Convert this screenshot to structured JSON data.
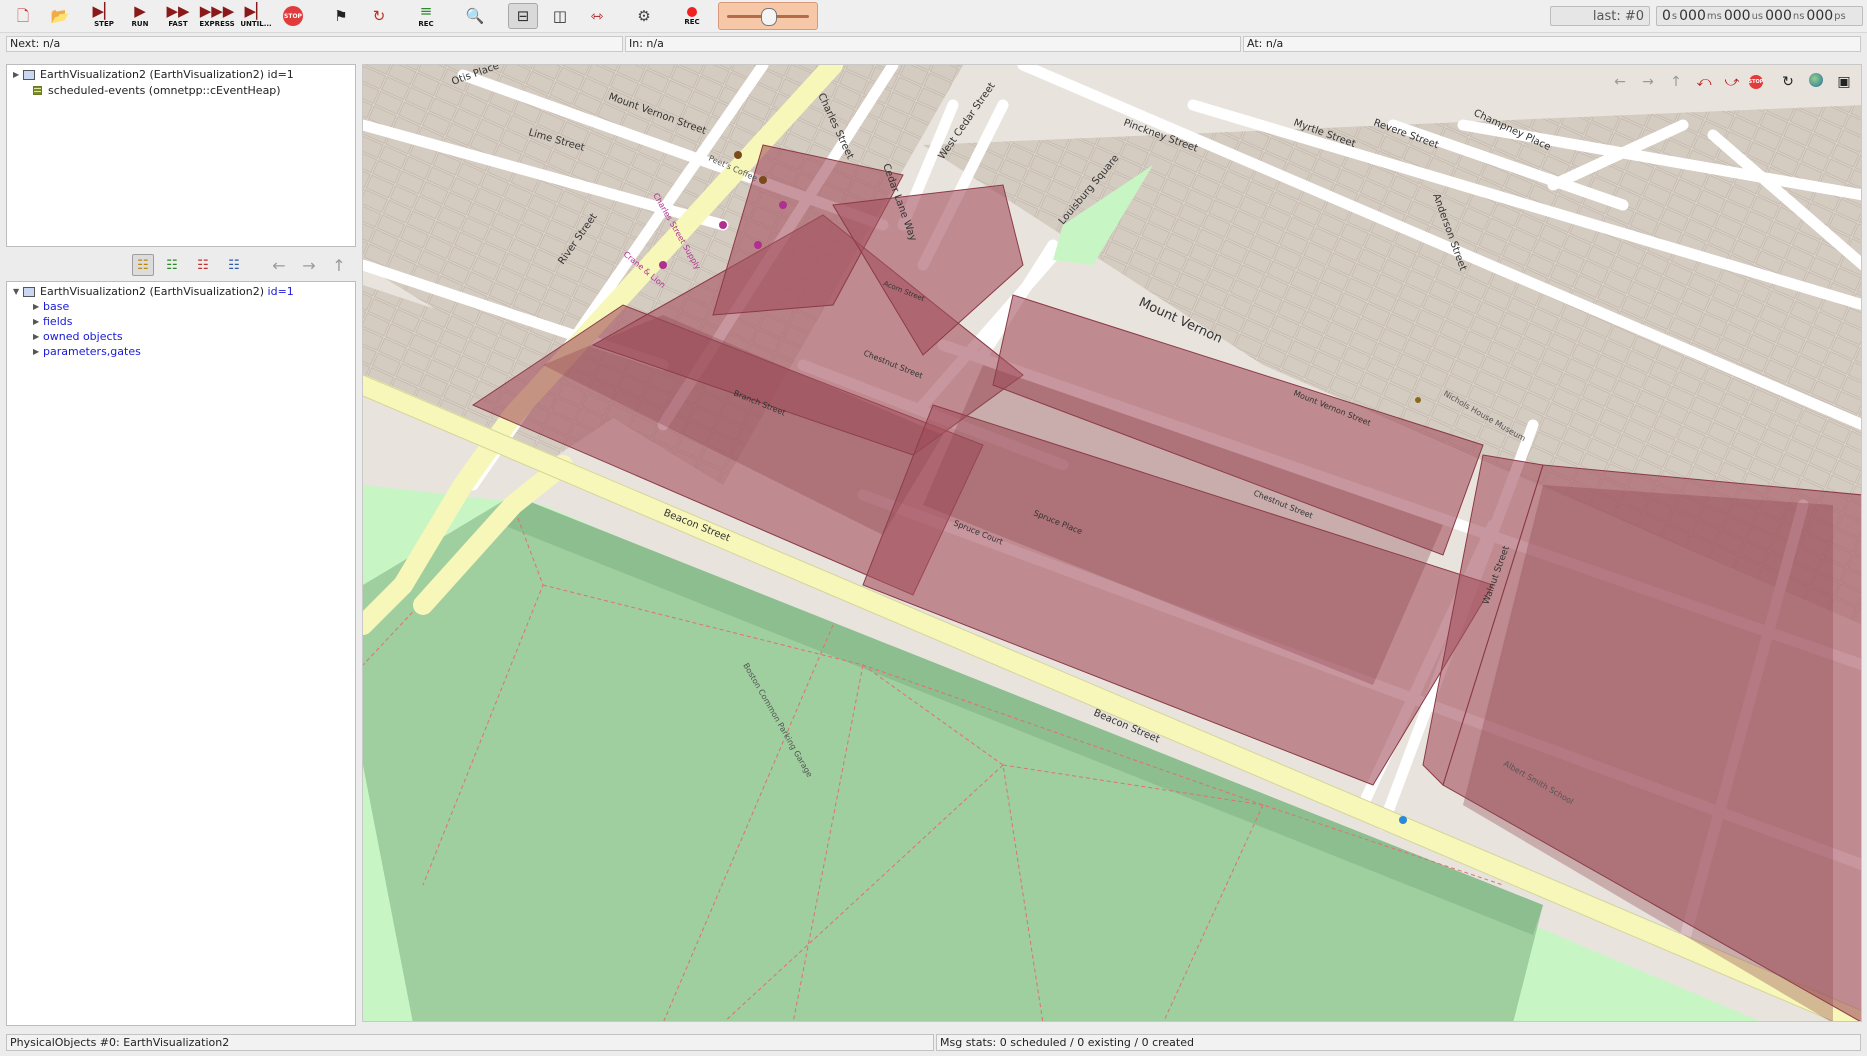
{
  "toolbar": {
    "step_label": "STEP",
    "run_label": "RUN",
    "fast_label": "FAST",
    "express_label": "EXPRESS",
    "until_label": "UNTIL...",
    "stop_label": "STOP",
    "rec_label": "REC",
    "speed_slider_fraction": 0.5,
    "last_event": "last: #0",
    "sim_time": {
      "s": "0",
      "ms": "000",
      "us": "000",
      "ns": "000",
      "ps": "000"
    },
    "unit_s": "s",
    "unit_ms": "ms",
    "unit_us": "us",
    "unit_ns": "ns",
    "unit_ps": "ps"
  },
  "info_bar": {
    "next": "Next: n/a",
    "in": "In: n/a",
    "at": "At: n/a"
  },
  "object_tree": {
    "items": [
      {
        "label": "EarthVisualization2 (EarthVisualization2) id=1",
        "icon": "module-icon"
      },
      {
        "label": "scheduled-events (omnetpp::cEventHeap)",
        "icon": "event-heap-icon"
      }
    ]
  },
  "inspector": {
    "root_label": "EarthVisualization2 (EarthVisualization2)",
    "root_id": "id=1",
    "groups": [
      "base",
      "fields",
      "owned objects",
      "parameters,gates"
    ]
  },
  "map": {
    "street_labels": [
      "Mount Vernon Street",
      "Lime Street",
      "Otis Place",
      "River Street",
      "Charles Street",
      "Cedar Lane Way",
      "West Cedar Street",
      "Louisburg Square",
      "Pinckney Street",
      "Myrtle Street",
      "Revere Street",
      "Champney Place",
      "Anderson Street",
      "Chestnut Street",
      "Branch Street",
      "Beacon Street",
      "Spruce Place",
      "Spruce Court",
      "Walnut Street",
      "Mount Vernon",
      "Acorn Street",
      "Mount Vernon Street",
      "Chestnut Street",
      "Beacon Street"
    ],
    "poi_labels": [
      "Peet's Coffee",
      "Charles Street Supply",
      "Crane & Lion",
      "Boston Common Parking Garage",
      "Nichols House Museum",
      "Albert Smith School"
    ],
    "colors": {
      "background": "#e8e4dd",
      "building": "#d8d0c6",
      "park": "#c8f5c4",
      "highlight": "#a04050",
      "major_road": "#f6f7b8"
    }
  },
  "status_bar": {
    "left": "PhysicalObjects #0: EarthVisualization2",
    "right": "Msg stats: 0 scheduled / 0 existing / 0 created"
  }
}
